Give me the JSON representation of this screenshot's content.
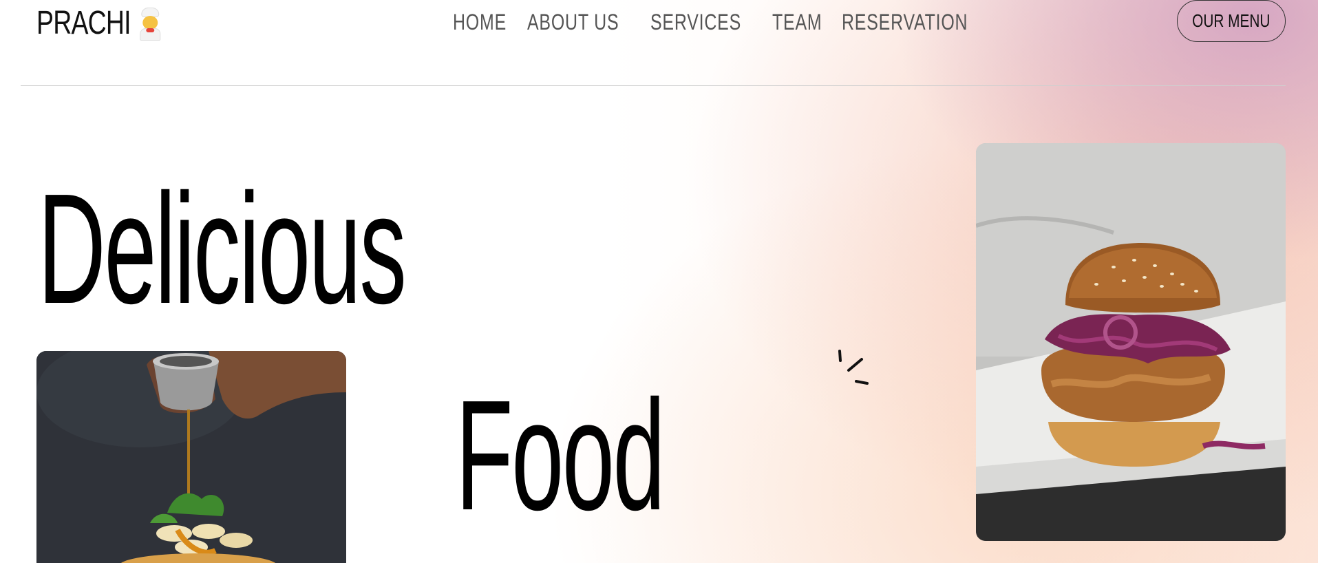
{
  "brand": {
    "name": "PRACHI",
    "icon": "chef-emoji-icon"
  },
  "nav": {
    "items": [
      "HOME",
      "ABOUT US",
      "SERVICES",
      "TEAM",
      "RESERVATION"
    ]
  },
  "cta": {
    "menu_label": "OUR MENU"
  },
  "hero": {
    "word_1": "Delicious",
    "word_2": "Food"
  },
  "images": {
    "left": "pancake-stack-syrup-image",
    "right": "burger-red-cabbage-image"
  },
  "colors": {
    "text": "#111111",
    "nav_text": "#555555",
    "glow_pink": "#cb96be",
    "glow_peach": "#eeaa96"
  }
}
